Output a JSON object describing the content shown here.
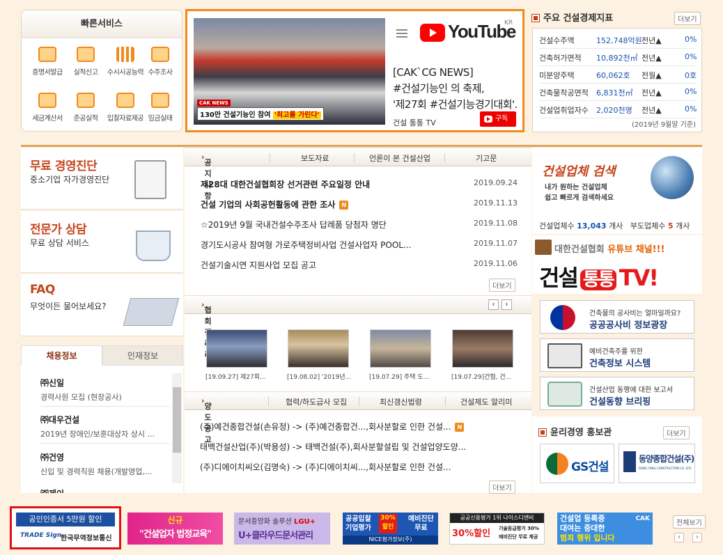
{
  "quick": {
    "title": "빠른서비스",
    "items": [
      "증명서발급",
      "실적신고",
      "수시시공능력",
      "수주조사",
      "세금계산서",
      "준공실적",
      "입찰자료제공",
      "임금실태"
    ]
  },
  "video": {
    "caption_prefix": "130만 건설기능인 참여",
    "caption_highlight": "'최고를 가린다'",
    "news_badge": "CAK NEWS",
    "logo_text": "YouTube",
    "logo_region": "KR",
    "title_lines": [
      "[CAK`CG NEWS]",
      "#건설기능인 의 축제,",
      "'제27회 #건설기능경기대회'..."
    ],
    "channel": "건설 통통 TV",
    "subscribe": "구독"
  },
  "indicators": {
    "title": "주요 건설경제지표",
    "more": "더보기",
    "rows": [
      {
        "name": "건설수주액",
        "value": "152,748억원",
        "cmp": "전년▲",
        "pct": "0%"
      },
      {
        "name": "건축허가면적",
        "value": "10,892천㎡",
        "cmp": "전년▲",
        "pct": "0%"
      },
      {
        "name": "미분양주택",
        "value": "60,062호",
        "cmp": "전월▲",
        "pct": "0호"
      },
      {
        "name": "건축물착공면적",
        "value": "6,831천㎡",
        "cmp": "전년▲",
        "pct": "0%"
      },
      {
        "name": "건설업취업자수",
        "value": "2,020천명",
        "cmp": "전년▲",
        "pct": "0%"
      }
    ],
    "note": "(2019년 9월말 기준)"
  },
  "left_boxes": [
    {
      "title": "무료 경영진단",
      "desc": "중소기업 자가경영진단"
    },
    {
      "title": "전문가 상담",
      "desc": "무료 상담 서비스"
    },
    {
      "title": "FAQ",
      "desc": "무엇이든 물어보세요?"
    }
  ],
  "notice": {
    "tabs": [
      "공지사항",
      "보도자료",
      "언론이 본 건설산업",
      "기고문"
    ],
    "rows": [
      {
        "title": "제28대 대한건설협회장 선거관련 주요일정 안내",
        "date": "2019.09.24",
        "bold": true,
        "new": false
      },
      {
        "title": "건설 기업의 사회공헌활동에 관한 조사",
        "date": "2019.11.13",
        "bold": true,
        "new": true
      },
      {
        "title": "☆2019년 9월 국내건설수주조사 답례품 당첨자 명단",
        "date": "2019.11.08",
        "bold": false,
        "new": false
      },
      {
        "title": "경기도시공사 참여형 가로주택정비사업 건설사업자 POOL...",
        "date": "2019.11.07",
        "bold": false,
        "new": false
      },
      {
        "title": "건설기술시연 지원사업 모집 공고",
        "date": "2019.11.06",
        "bold": false,
        "new": false
      }
    ],
    "more": "더보기",
    "new_label": "N"
  },
  "gallery": {
    "title": "협회갤러리",
    "prev": "‹",
    "next": "›",
    "items": [
      "[19.09.27] 제27회...",
      "[19.08.02] '2019년...",
      "[19.07.29] 주택 도...",
      "[19.07.29]건협, 건..."
    ]
  },
  "transfer": {
    "tabs": [
      "양도공고",
      "협력/하도급사 모집",
      "최신갱신법령",
      "건설제도 알리미"
    ],
    "rows": [
      {
        "title": "(주)예건종합건설(손유정) -> (주)예건종합건...,회사분할로 인한 건설...",
        "new": true
      },
      {
        "title": "태백건설산업(주)(박용성) -> 태백건설(주),회사분할설립 및 건설업양도양...",
        "new": false
      },
      {
        "title": "(주)디에이치씨오(김명숙) -> (주)디에이치씨...,회사분할로 인한 건설...",
        "new": false
      }
    ],
    "more": "더보기"
  },
  "jobs": {
    "tab_active": "채용정보",
    "tab_other": "인재정보",
    "items": [
      {
        "company": "㈜신일",
        "desc": "경력사원 모집 (현장공사)"
      },
      {
        "company": "㈜대우건설",
        "desc": "2019년 장애인/보훈대상자 상시 ..."
      },
      {
        "company": "㈜건영",
        "desc": "신입 및 경력직원 채용(개발영업,..."
      },
      {
        "company": "㈜제이",
        "desc": ""
      }
    ]
  },
  "search": {
    "title": "건설업체 검색",
    "desc_lines": [
      "내가 원하는 건설업체",
      "쉽고 빠르게 검색하세요"
    ],
    "count_label": "건설업체수",
    "count_value": "13,043",
    "count_unit": "개사",
    "sub_label": "부도업체수",
    "sub_value": "5",
    "sub_unit": "개사"
  },
  "tv": {
    "line1_prefix": "대한건설협회",
    "line1_highlight": "유튜브 채널!!!",
    "big_prefix": "건설",
    "big_mid": "통통",
    "big_suffix": "TV!"
  },
  "links": [
    {
      "t1": "건축물의 공사비는 얼마일까요?",
      "t2": "공공공사비 정보광장"
    },
    {
      "t1": "예비건축주를 위한",
      "t2": "건축정보 시스템"
    },
    {
      "t1": "건설산업 동행에 대한 보고서",
      "t2": "건설동향 브리핑"
    }
  ],
  "ethic": {
    "title": "윤리경영 홍보관",
    "more": "더보기",
    "logo1": "GS건설",
    "logo2_kr": "동양종합건설(주)",
    "logo2_en": "DONG YANG CONSTRUCTION CO.,LTD."
  },
  "banners": {
    "b1_top": "공인인증서 5만원 할인",
    "b1_brand": "TRADE Sign",
    "b1_company": "한국무역정보통신",
    "b2_top": "신규",
    "b2_main": "\"건설업자 법정교육\"",
    "b3_top": "문서중앙화 솔루션",
    "b3_brand": "LGU+",
    "b3_main": "U+클라우드문서관리",
    "b4_l1": "공공입찰",
    "b4_l2": "기업평가",
    "b4_pct": "30%",
    "b4_sale": "할인",
    "b4_r1": "예비진단",
    "b4_r2": "무료",
    "b4_footer": "NICE평가정보(주)",
    "b5_l1": "공공신용평가 1위 나이스디앤비",
    "b5_pct": "30%할인",
    "b5_r1": "기술등급평가 30%",
    "b5_r2": "예비진단 무료 제공",
    "b6_l1": "건설업 등록증",
    "b6_l2": "대여는 중대한",
    "b6_l3": "범죄 행위 입니다",
    "b6_logo": "CAK",
    "view_all": "전체보기",
    "prev": "‹",
    "next": "›"
  }
}
